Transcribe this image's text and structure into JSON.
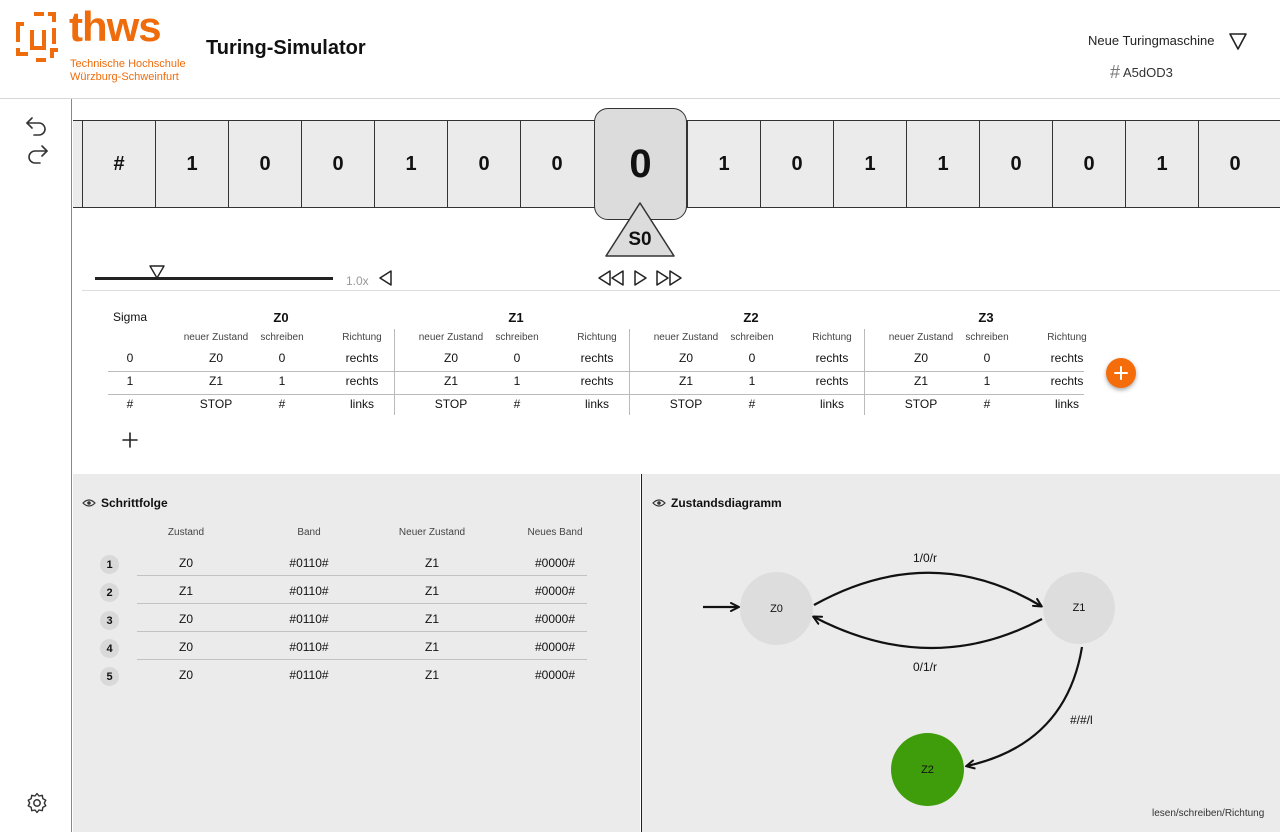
{
  "brand": {
    "name": "thws",
    "subline1": "Technische Hochschule",
    "subline2": "Würzburg-Schweinfurt",
    "color": "#ee6c0c"
  },
  "app": {
    "title": "Turing-Simulator"
  },
  "machine": {
    "name": "Neue Turingmaschine",
    "id": "A5dOD3"
  },
  "tape": {
    "cells_left": [
      "#",
      "1",
      "0",
      "0",
      "1",
      "0",
      "0"
    ],
    "head_value": "0",
    "cells_right": [
      "1",
      "0",
      "1",
      "1",
      "0",
      "0",
      "1",
      "0"
    ],
    "head_state": "S0"
  },
  "controls": {
    "speed": "1.0x",
    "speed_level": 0.26
  },
  "transition_table": {
    "sigma_label": "Sigma",
    "sub_headers": [
      "neuer Zustand",
      "schreiben",
      "Richtung"
    ],
    "states": [
      "Z0",
      "Z1",
      "Z2",
      "Z3"
    ],
    "symbols": [
      "0",
      "1",
      "#"
    ],
    "rows": [
      [
        [
          "Z0",
          "0",
          "rechts"
        ],
        [
          "Z0",
          "0",
          "rechts"
        ],
        [
          "Z0",
          "0",
          "rechts"
        ],
        [
          "Z0",
          "0",
          "rechts"
        ]
      ],
      [
        [
          "Z1",
          "1",
          "rechts"
        ],
        [
          "Z1",
          "1",
          "rechts"
        ],
        [
          "Z1",
          "1",
          "rechts"
        ],
        [
          "Z1",
          "1",
          "rechts"
        ]
      ],
      [
        [
          "STOP",
          "#",
          "links"
        ],
        [
          "STOP",
          "#",
          "links"
        ],
        [
          "STOP",
          "#",
          "links"
        ],
        [
          "STOP",
          "#",
          "links"
        ]
      ]
    ]
  },
  "steps": {
    "title": "Schrittfolge",
    "columns": [
      "Zustand",
      "Band",
      "Neuer Zustand",
      "Neues Band"
    ],
    "rows": [
      {
        "n": "1",
        "state": "Z0",
        "band": "#0110#",
        "new_state": "Z1",
        "new_band": "#0000#"
      },
      {
        "n": "2",
        "state": "Z1",
        "band": "#0110#",
        "new_state": "Z1",
        "new_band": "#0000#"
      },
      {
        "n": "3",
        "state": "Z0",
        "band": "#0110#",
        "new_state": "Z1",
        "new_band": "#0000#"
      },
      {
        "n": "4",
        "state": "Z0",
        "band": "#0110#",
        "new_state": "Z1",
        "new_band": "#0000#"
      },
      {
        "n": "5",
        "state": "Z0",
        "band": "#0110#",
        "new_state": "Z1",
        "new_band": "#0000#"
      }
    ]
  },
  "diagram": {
    "title": "Zustandsdiagramm",
    "nodes": [
      "Z0",
      "Z1",
      "Z2"
    ],
    "edges": [
      "1/0/r",
      "0/1/r",
      "#/#/l"
    ],
    "hint": "lesen/schreiben/Richtung",
    "node_color": "#dddddd",
    "final_color": "#3f9c0a"
  }
}
